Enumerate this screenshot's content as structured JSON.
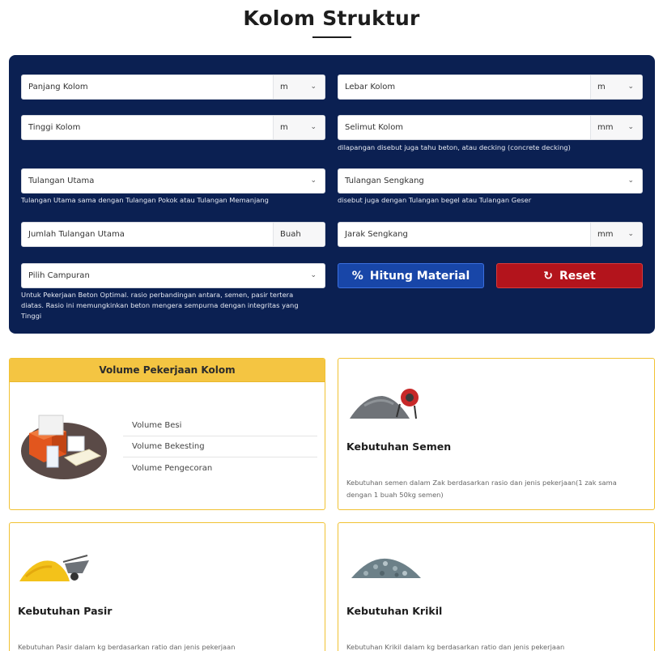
{
  "page": {
    "title": "Kolom Struktur"
  },
  "form": {
    "panjang_kolom": {
      "label": "Panjang Kolom",
      "unit": "m"
    },
    "lebar_kolom": {
      "label": "Lebar Kolom",
      "unit": "m"
    },
    "tinggi_kolom": {
      "label": "Tinggi Kolom",
      "unit": "m"
    },
    "selimut_kolom": {
      "label": "Selimut Kolom",
      "unit": "mm",
      "hint": "dilapangan disebut juga tahu beton, atau decking (concrete decking)"
    },
    "tulangan_utama": {
      "label": "Tulangan Utama",
      "hint": "Tulangan Utama sama dengan Tulangan Pokok atau Tulangan Memanjang"
    },
    "tulangan_sengkang": {
      "label": "Tulangan Sengkang",
      "hint": "disebut juga dengan Tulangan begel atau Tulangan Geser"
    },
    "jumlah_tulangan": {
      "label": "Jumlah Tulangan Utama",
      "unit": "Buah"
    },
    "jarak_sengkang": {
      "label": "Jarak Sengkang",
      "unit": "mm"
    },
    "campuran": {
      "label": "Pilih Campuran",
      "hint": "Untuk Pekerjaan Beton Optimal. rasio perbandingan antara, semen, pasir tertera diatas. Rasio ini memungkinkan beton mengera sempurna dengan integritas yang Tinggi"
    },
    "btn_hitung": "Hitung Material",
    "btn_reset": "Reset"
  },
  "volume_card": {
    "title": "Volume Pekerjaan Kolom",
    "items": [
      "Volume Besi",
      "Volume Bekesting",
      "Volume Pengecoran"
    ]
  },
  "semen_card": {
    "title": "Kebutuhan Semen",
    "desc": "Kebutuhan semen dalam Zak berdasarkan rasio dan jenis pekerjaan(1 zak sama dengan 1 buah 50kg semen)"
  },
  "pasir_card": {
    "title": "Kebutuhan Pasir",
    "desc": "Kebutuhan Pasir dalam kg berdasarkan ratio dan jenis pekerjaan"
  },
  "krikil_card": {
    "title": "Kebutuhan Krikil",
    "desc": "Kebutuhan Krikil dalam kg berdasarkan ratio dan jenis pekerjaan"
  },
  "colors": {
    "panel": "#0b2052",
    "accent_yellow": "#f4c542",
    "btn_calc": "#1846a8",
    "btn_reset": "#b3141c"
  }
}
